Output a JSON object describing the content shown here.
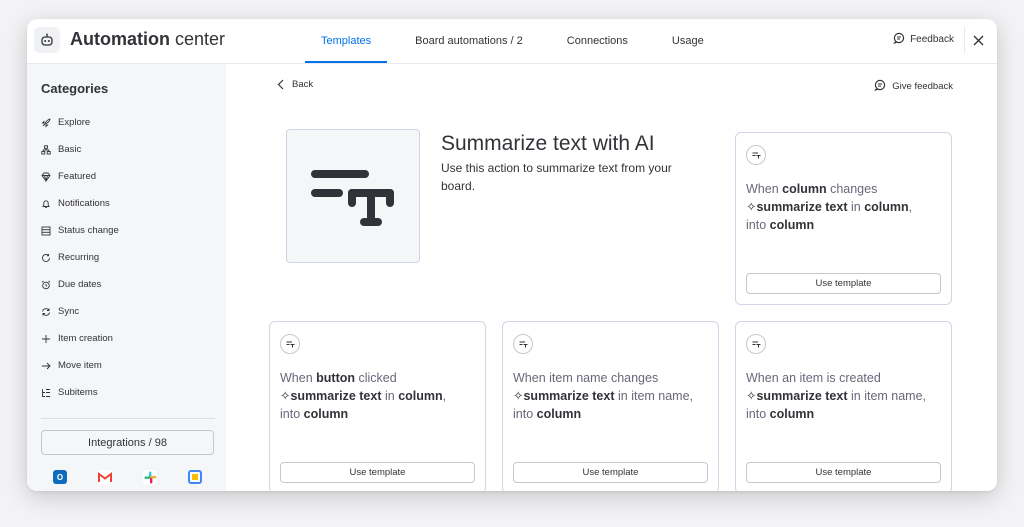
{
  "header": {
    "title_bold": "Automation",
    "title_light": "center",
    "tabs": [
      {
        "label": "Templates",
        "active": true
      },
      {
        "label": "Board automations / 2",
        "active": false
      },
      {
        "label": "Connections",
        "active": false
      },
      {
        "label": "Usage",
        "active": false
      }
    ],
    "feedback_label": "Feedback"
  },
  "sidebar": {
    "title": "Categories",
    "items": [
      {
        "label": "Explore",
        "icon": "rocket-icon"
      },
      {
        "label": "Basic",
        "icon": "hierarchy-icon"
      },
      {
        "label": "Featured",
        "icon": "diamond-icon"
      },
      {
        "label": "Notifications",
        "icon": "bell-icon"
      },
      {
        "label": "Status change",
        "icon": "status-icon"
      },
      {
        "label": "Recurring",
        "icon": "recurring-icon"
      },
      {
        "label": "Due dates",
        "icon": "alarm-icon"
      },
      {
        "label": "Sync",
        "icon": "sync-icon"
      },
      {
        "label": "Item creation",
        "icon": "plus-icon"
      },
      {
        "label": "Move item",
        "icon": "arrow-right-icon"
      },
      {
        "label": "Subitems",
        "icon": "subitems-icon"
      }
    ],
    "integrations_label": "Integrations / 98",
    "integration_icons": [
      "outlook-icon",
      "gmail-icon",
      "slack-icon",
      "google-calendar-icon"
    ]
  },
  "main": {
    "back_label": "Back",
    "give_feedback_label": "Give feedback",
    "hero": {
      "title": "Summarize text with AI",
      "description": "Use this action to summarize text from your board."
    },
    "use_template_label": "Use template",
    "cards": [
      {
        "trigger_pre": "When ",
        "trigger_bold": "column",
        "trigger_post": " changes",
        "action": "summarize text",
        "in_word": " in ",
        "source": "column",
        "source_bold": true,
        "into": "into ",
        "target": "column"
      },
      {
        "trigger_pre": "When ",
        "trigger_bold": "button",
        "trigger_post": " clicked",
        "action": "summarize text",
        "in_word": " in ",
        "source": "column",
        "source_bold": true,
        "into": "into ",
        "target": "column"
      },
      {
        "trigger_pre": "When item name changes",
        "trigger_bold": "",
        "trigger_post": "",
        "action": "summarize text",
        "in_word": " in ",
        "source": "item name",
        "source_bold": false,
        "into": "into ",
        "target": "column"
      },
      {
        "trigger_pre": "When an item is created",
        "trigger_bold": "",
        "trigger_post": "",
        "action": "summarize text",
        "in_word": " in ",
        "source": "item name",
        "source_bold": false,
        "into": "into ",
        "target": "column"
      }
    ]
  },
  "colors": {
    "accent": "#0073ea",
    "border": "#d0d4e4",
    "sidebar_bg": "#f5f6f8"
  }
}
